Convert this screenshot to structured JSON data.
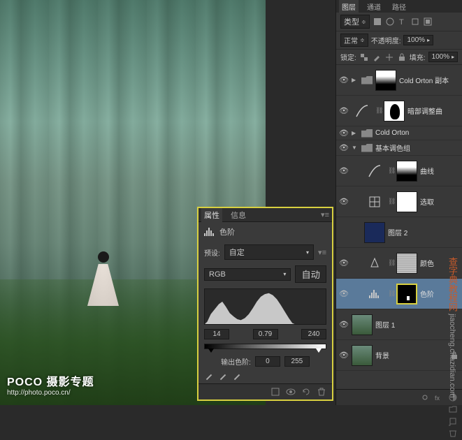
{
  "watermark": {
    "title": "POCO 摄影专题",
    "url": "http://photo.poco.cn/"
  },
  "side_watermark": {
    "cn": "查字典教程网",
    "url": "jiaocheng.chazidian.com"
  },
  "properties": {
    "tab_properties": "属性",
    "tab_info": "信息",
    "adjustment_name": "色阶",
    "preset_label": "预设:",
    "preset_value": "自定",
    "channel_value": "RGB",
    "auto_button": "自动",
    "input_black": "14",
    "input_gamma": "0.79",
    "input_white": "240",
    "output_label": "输出色阶:",
    "output_black": "0",
    "output_white": "255"
  },
  "layers_panel": {
    "tab_layers": "图层",
    "tab_channels": "通道",
    "tab_paths": "路径",
    "kind_label": "类型",
    "blend_mode": "正常",
    "opacity_label": "不透明度:",
    "opacity_value": "100%",
    "lock_label": "锁定:",
    "fill_label": "填充:",
    "fill_value": "100%",
    "layers": {
      "group_cold_orton_copy": "Cold Orton 副本",
      "dark_curves": "暗部调整曲",
      "group_cold_orton": "Cold Orton",
      "group_basic": "基本调色组",
      "curves_1": "曲线",
      "selective": "选取",
      "layer_2": "图层 2",
      "color_balance": "颜色",
      "levels": "色阶",
      "layer_1": "图层 1",
      "background": "背景"
    }
  }
}
